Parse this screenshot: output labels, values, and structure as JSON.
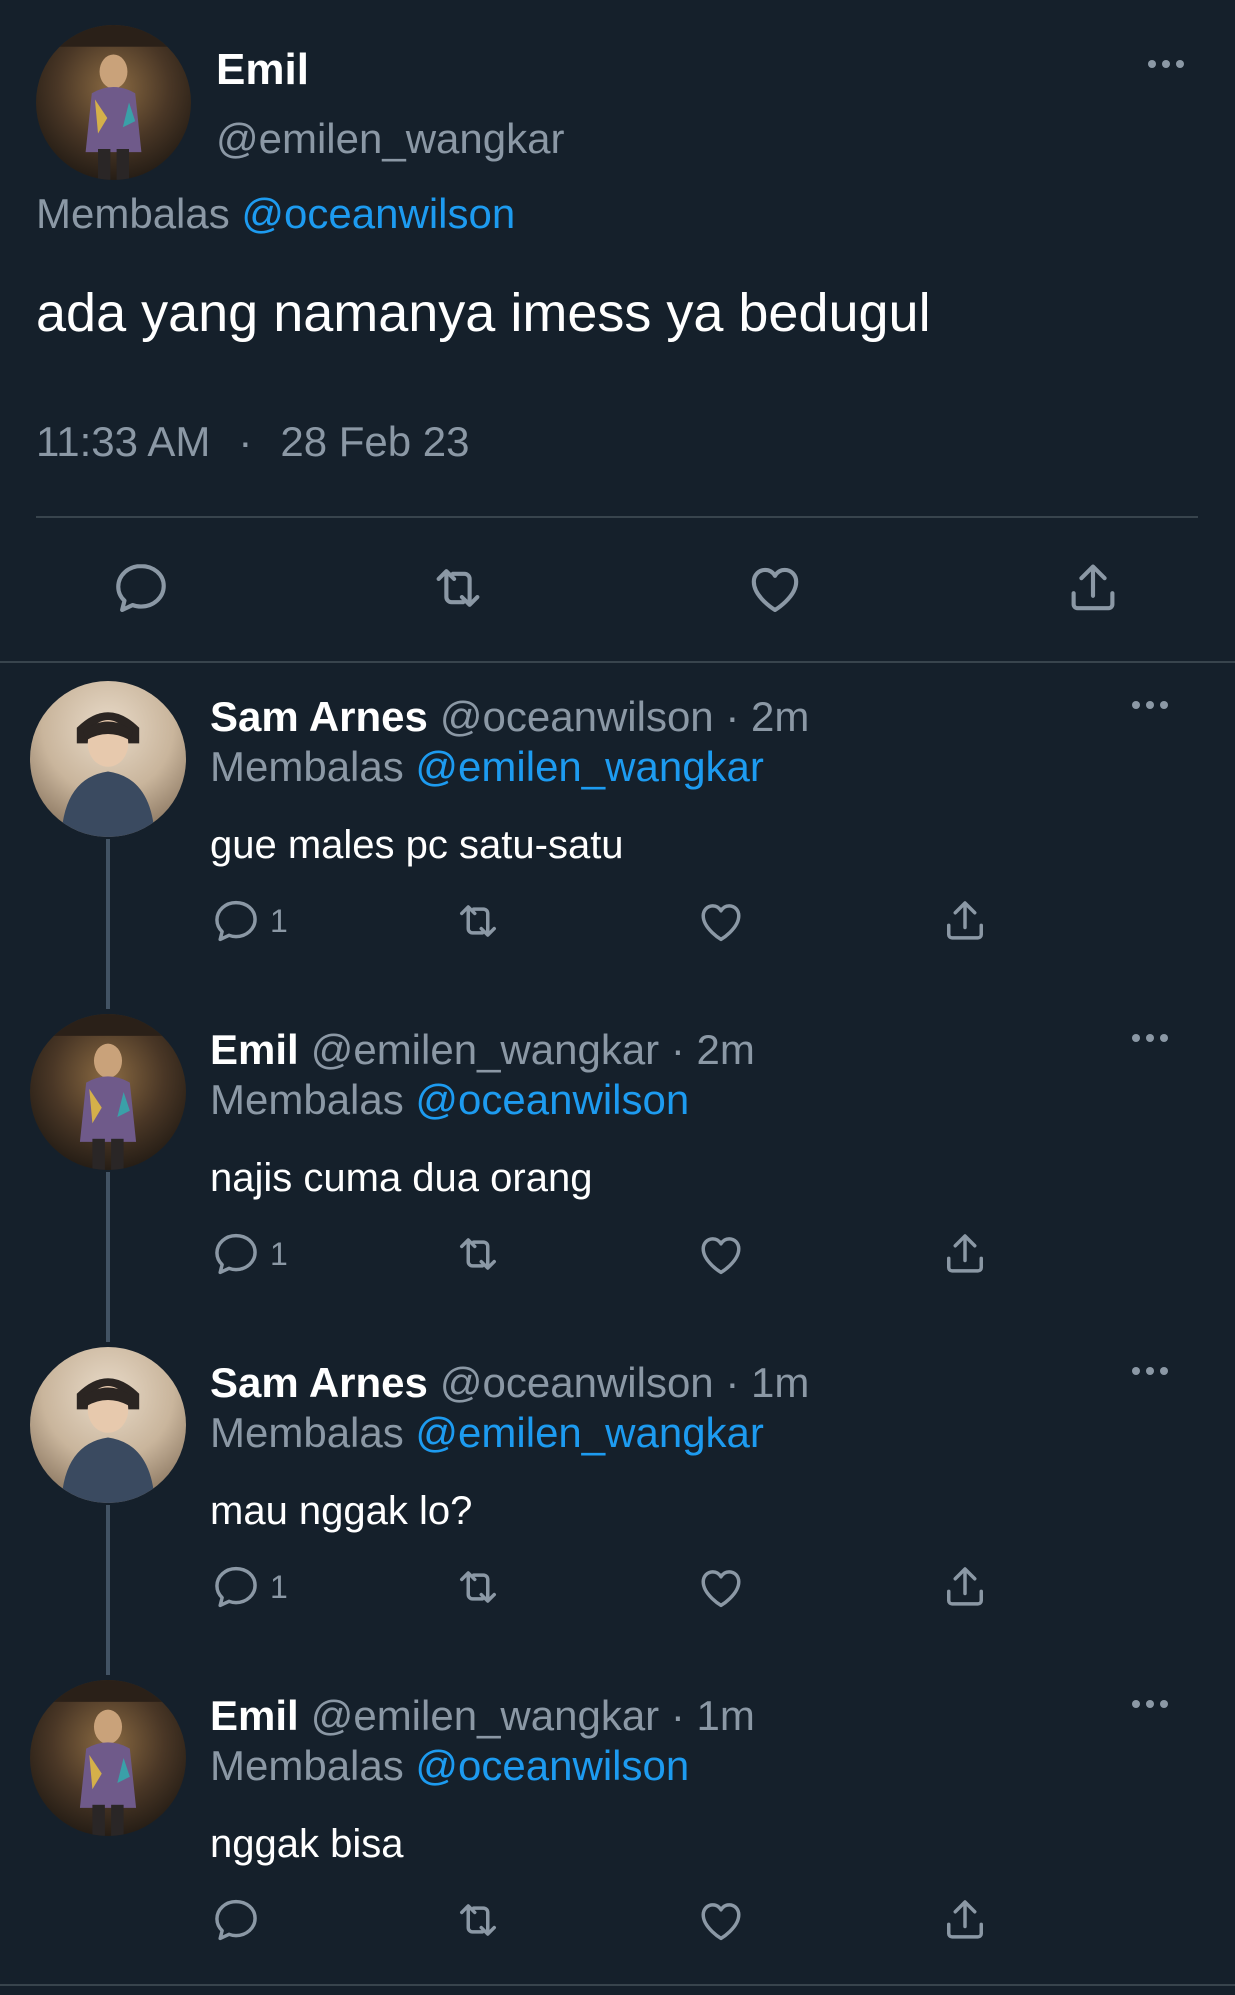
{
  "main_tweet": {
    "author_name": "Emil",
    "author_handle": "@emilen_wangkar",
    "replying_label": "Membalas",
    "replying_to": "@oceanwilson",
    "text": "ada yang namanya imess ya bedugul",
    "time": "11:33 AM",
    "separator": "·",
    "date": "28 Feb 23",
    "actions": [
      {
        "icon": "reply-icon"
      },
      {
        "icon": "retweet-icon"
      },
      {
        "icon": "like-icon"
      },
      {
        "icon": "share-icon"
      }
    ]
  },
  "replies": [
    {
      "name": "Sam Arnes",
      "handle": "@oceanwilson",
      "time": "· 2m",
      "replying_label": "Membalas",
      "replying_to": "@emilen_wangkar",
      "text": "gue males pc satu-satu",
      "reply_count": "1",
      "avatar": "sam"
    },
    {
      "name": "Emil",
      "handle": "@emilen_wangkar",
      "time": "· 2m",
      "replying_label": "Membalas",
      "replying_to": "@oceanwilson",
      "text": "najis cuma dua orang",
      "reply_count": "1",
      "avatar": "emil"
    },
    {
      "name": "Sam Arnes",
      "handle": "@oceanwilson",
      "time": "· 1m",
      "replying_label": "Membalas",
      "replying_to": "@emilen_wangkar",
      "text": "mau nggak lo?",
      "reply_count": "1",
      "avatar": "sam"
    },
    {
      "name": "Emil",
      "handle": "@emilen_wangkar",
      "time": "· 1m",
      "replying_label": "Membalas",
      "replying_to": "@oceanwilson",
      "text": "nggak bisa",
      "reply_count": "",
      "avatar": "emil"
    }
  ],
  "colors": {
    "background": "#15202b",
    "text": "#ffffff",
    "muted": "#8b98a5",
    "link": "#1d9bf0",
    "divider": "#38444d"
  }
}
